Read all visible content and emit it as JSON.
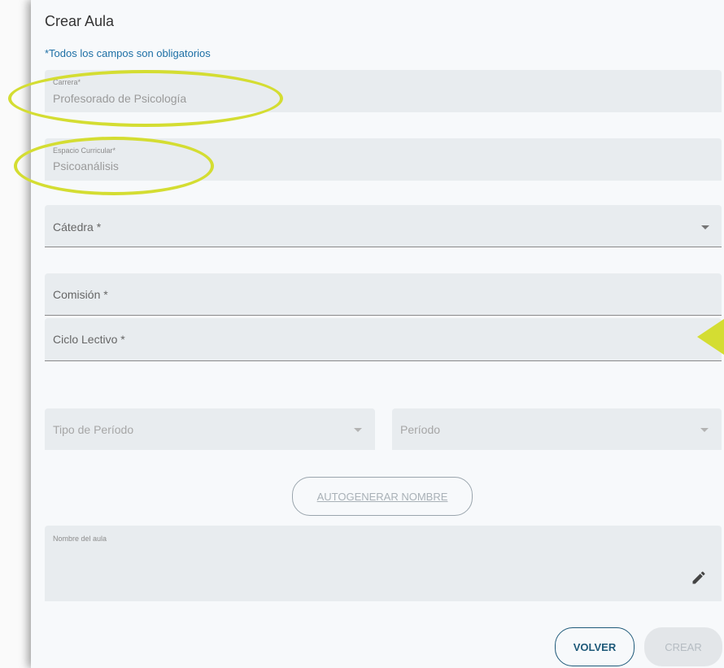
{
  "dialog": {
    "title": "Crear Aula",
    "required_note": "*Todos los campos son obligatorios"
  },
  "fields": {
    "carrera": {
      "label": "Carrera*",
      "value": "Profesorado de Psicología"
    },
    "espacio_curricular": {
      "label": "Espacio Curricular*",
      "value": "Psicoanálisis"
    },
    "catedra": {
      "placeholder": "Cátedra *",
      "icon": "chevron-down-icon"
    },
    "comision": {
      "placeholder": "Comisión *"
    },
    "ciclo_lectivo": {
      "placeholder": "Ciclo Lectivo *",
      "icon": "chevron-down-icon"
    },
    "tipo_periodo": {
      "placeholder": "Tipo de Período",
      "icon": "chevron-down-icon"
    },
    "periodo": {
      "placeholder": "Período",
      "icon": "chevron-down-icon"
    },
    "nombre_aula": {
      "label": "Nombre del aula",
      "value": "",
      "icon": "pencil-icon"
    }
  },
  "buttons": {
    "autogenerar": "AUTOGENERAR NOMBRE",
    "volver": "VOLVER",
    "crear": "CREAR"
  },
  "annotations": {
    "highlight_color": "#d4dd32"
  },
  "colors": {
    "accent": "#1d6fa5",
    "primary_button": "#1f5a7a",
    "field_bg": "#e8ecef"
  }
}
